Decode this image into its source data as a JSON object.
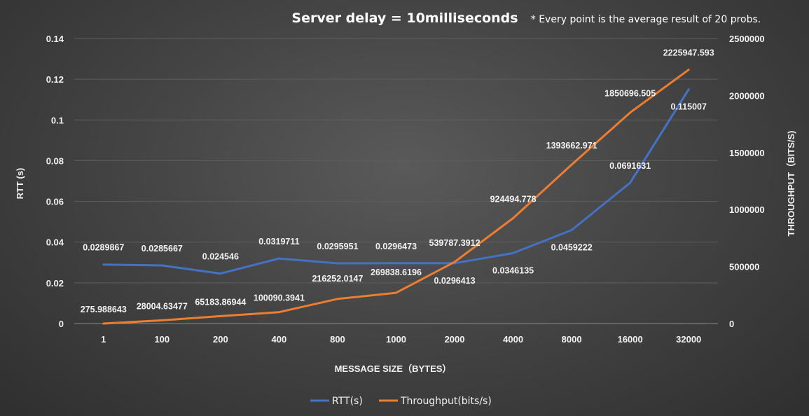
{
  "chart_data": {
    "type": "line",
    "title": "Server delay = 10milliseconds",
    "note": "* Every point is the average result of 20 probs.",
    "xlabel": "MESSAGE SIZE（BYTES）",
    "ylabel": "RTT  (s)",
    "y2label": "THROUGHPUT（BITS/S)",
    "categories": [
      "1",
      "100",
      "200",
      "400",
      "800",
      "1000",
      "2000",
      "4000",
      "8000",
      "16000",
      "32000"
    ],
    "ylim": [
      0,
      0.14
    ],
    "yticks": [
      "0",
      "0.02",
      "0.04",
      "0.06",
      "0.08",
      "0.1",
      "0.12",
      "0.14"
    ],
    "y2lim": [
      0,
      2500000
    ],
    "y2ticks": [
      "0",
      "500000",
      "1000000",
      "1500000",
      "2000000",
      "2500000"
    ],
    "grid": true,
    "legend_position": "bottom",
    "series": [
      {
        "name": "RTT(s)",
        "axis": "left",
        "color": "#4472c4",
        "values": [
          0.0289867,
          0.0285667,
          0.024546,
          0.0319711,
          0.0295951,
          0.0296473,
          0.0296413,
          0.0346135,
          0.0459222,
          0.0691631,
          0.115007
        ],
        "labels": [
          "0.0289867",
          "0.0285667",
          "0.024546",
          "0.0319711",
          "0.0295951",
          "0.0296473",
          "0.0296413",
          "0.0346135",
          "0.0459222",
          "0.0691631",
          "0.115007"
        ]
      },
      {
        "name": "Throughput(bits/s)",
        "axis": "right",
        "color": "#ed7d31",
        "values": [
          275.988643,
          28004.63477,
          65183.86944,
          100090.3941,
          216252.0147,
          269838.6196,
          539787.3912,
          924494.778,
          1393662.971,
          1850696.505,
          2225947.593
        ],
        "labels": [
          "275.988643",
          "28004.63477",
          "65183.86944",
          "100090.3941",
          "216252.0147",
          "269838.6196",
          "539787.3912",
          "924494.778",
          "1393662.971",
          "1850696.505",
          "2225947.593"
        ]
      }
    ]
  }
}
